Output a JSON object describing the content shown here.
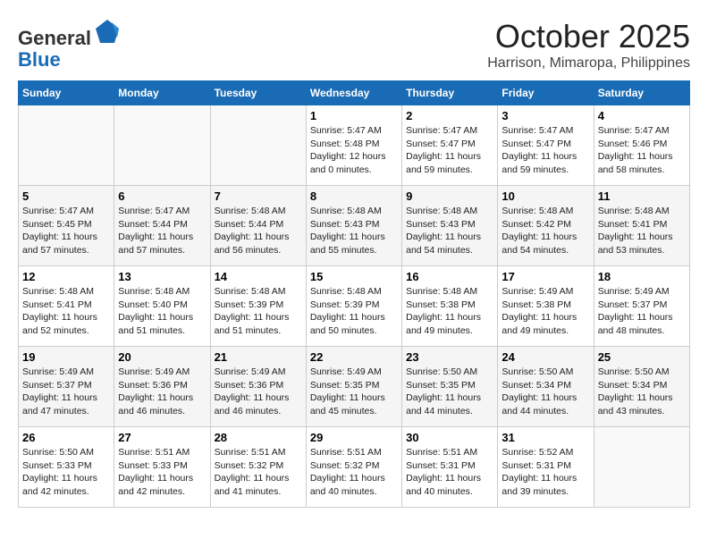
{
  "header": {
    "logo_line1": "General",
    "logo_line2": "Blue",
    "month": "October 2025",
    "location": "Harrison, Mimaropa, Philippines"
  },
  "days_of_week": [
    "Sunday",
    "Monday",
    "Tuesday",
    "Wednesday",
    "Thursday",
    "Friday",
    "Saturday"
  ],
  "weeks": [
    [
      {
        "day": "",
        "sunrise": "",
        "sunset": "",
        "daylight": ""
      },
      {
        "day": "",
        "sunrise": "",
        "sunset": "",
        "daylight": ""
      },
      {
        "day": "",
        "sunrise": "",
        "sunset": "",
        "daylight": ""
      },
      {
        "day": "1",
        "sunrise": "Sunrise: 5:47 AM",
        "sunset": "Sunset: 5:48 PM",
        "daylight": "Daylight: 12 hours and 0 minutes."
      },
      {
        "day": "2",
        "sunrise": "Sunrise: 5:47 AM",
        "sunset": "Sunset: 5:47 PM",
        "daylight": "Daylight: 11 hours and 59 minutes."
      },
      {
        "day": "3",
        "sunrise": "Sunrise: 5:47 AM",
        "sunset": "Sunset: 5:47 PM",
        "daylight": "Daylight: 11 hours and 59 minutes."
      },
      {
        "day": "4",
        "sunrise": "Sunrise: 5:47 AM",
        "sunset": "Sunset: 5:46 PM",
        "daylight": "Daylight: 11 hours and 58 minutes."
      }
    ],
    [
      {
        "day": "5",
        "sunrise": "Sunrise: 5:47 AM",
        "sunset": "Sunset: 5:45 PM",
        "daylight": "Daylight: 11 hours and 57 minutes."
      },
      {
        "day": "6",
        "sunrise": "Sunrise: 5:47 AM",
        "sunset": "Sunset: 5:44 PM",
        "daylight": "Daylight: 11 hours and 57 minutes."
      },
      {
        "day": "7",
        "sunrise": "Sunrise: 5:48 AM",
        "sunset": "Sunset: 5:44 PM",
        "daylight": "Daylight: 11 hours and 56 minutes."
      },
      {
        "day": "8",
        "sunrise": "Sunrise: 5:48 AM",
        "sunset": "Sunset: 5:43 PM",
        "daylight": "Daylight: 11 hours and 55 minutes."
      },
      {
        "day": "9",
        "sunrise": "Sunrise: 5:48 AM",
        "sunset": "Sunset: 5:43 PM",
        "daylight": "Daylight: 11 hours and 54 minutes."
      },
      {
        "day": "10",
        "sunrise": "Sunrise: 5:48 AM",
        "sunset": "Sunset: 5:42 PM",
        "daylight": "Daylight: 11 hours and 54 minutes."
      },
      {
        "day": "11",
        "sunrise": "Sunrise: 5:48 AM",
        "sunset": "Sunset: 5:41 PM",
        "daylight": "Daylight: 11 hours and 53 minutes."
      }
    ],
    [
      {
        "day": "12",
        "sunrise": "Sunrise: 5:48 AM",
        "sunset": "Sunset: 5:41 PM",
        "daylight": "Daylight: 11 hours and 52 minutes."
      },
      {
        "day": "13",
        "sunrise": "Sunrise: 5:48 AM",
        "sunset": "Sunset: 5:40 PM",
        "daylight": "Daylight: 11 hours and 51 minutes."
      },
      {
        "day": "14",
        "sunrise": "Sunrise: 5:48 AM",
        "sunset": "Sunset: 5:39 PM",
        "daylight": "Daylight: 11 hours and 51 minutes."
      },
      {
        "day": "15",
        "sunrise": "Sunrise: 5:48 AM",
        "sunset": "Sunset: 5:39 PM",
        "daylight": "Daylight: 11 hours and 50 minutes."
      },
      {
        "day": "16",
        "sunrise": "Sunrise: 5:48 AM",
        "sunset": "Sunset: 5:38 PM",
        "daylight": "Daylight: 11 hours and 49 minutes."
      },
      {
        "day": "17",
        "sunrise": "Sunrise: 5:49 AM",
        "sunset": "Sunset: 5:38 PM",
        "daylight": "Daylight: 11 hours and 49 minutes."
      },
      {
        "day": "18",
        "sunrise": "Sunrise: 5:49 AM",
        "sunset": "Sunset: 5:37 PM",
        "daylight": "Daylight: 11 hours and 48 minutes."
      }
    ],
    [
      {
        "day": "19",
        "sunrise": "Sunrise: 5:49 AM",
        "sunset": "Sunset: 5:37 PM",
        "daylight": "Daylight: 11 hours and 47 minutes."
      },
      {
        "day": "20",
        "sunrise": "Sunrise: 5:49 AM",
        "sunset": "Sunset: 5:36 PM",
        "daylight": "Daylight: 11 hours and 46 minutes."
      },
      {
        "day": "21",
        "sunrise": "Sunrise: 5:49 AM",
        "sunset": "Sunset: 5:36 PM",
        "daylight": "Daylight: 11 hours and 46 minutes."
      },
      {
        "day": "22",
        "sunrise": "Sunrise: 5:49 AM",
        "sunset": "Sunset: 5:35 PM",
        "daylight": "Daylight: 11 hours and 45 minutes."
      },
      {
        "day": "23",
        "sunrise": "Sunrise: 5:50 AM",
        "sunset": "Sunset: 5:35 PM",
        "daylight": "Daylight: 11 hours and 44 minutes."
      },
      {
        "day": "24",
        "sunrise": "Sunrise: 5:50 AM",
        "sunset": "Sunset: 5:34 PM",
        "daylight": "Daylight: 11 hours and 44 minutes."
      },
      {
        "day": "25",
        "sunrise": "Sunrise: 5:50 AM",
        "sunset": "Sunset: 5:34 PM",
        "daylight": "Daylight: 11 hours and 43 minutes."
      }
    ],
    [
      {
        "day": "26",
        "sunrise": "Sunrise: 5:50 AM",
        "sunset": "Sunset: 5:33 PM",
        "daylight": "Daylight: 11 hours and 42 minutes."
      },
      {
        "day": "27",
        "sunrise": "Sunrise: 5:51 AM",
        "sunset": "Sunset: 5:33 PM",
        "daylight": "Daylight: 11 hours and 42 minutes."
      },
      {
        "day": "28",
        "sunrise": "Sunrise: 5:51 AM",
        "sunset": "Sunset: 5:32 PM",
        "daylight": "Daylight: 11 hours and 41 minutes."
      },
      {
        "day": "29",
        "sunrise": "Sunrise: 5:51 AM",
        "sunset": "Sunset: 5:32 PM",
        "daylight": "Daylight: 11 hours and 40 minutes."
      },
      {
        "day": "30",
        "sunrise": "Sunrise: 5:51 AM",
        "sunset": "Sunset: 5:31 PM",
        "daylight": "Daylight: 11 hours and 40 minutes."
      },
      {
        "day": "31",
        "sunrise": "Sunrise: 5:52 AM",
        "sunset": "Sunset: 5:31 PM",
        "daylight": "Daylight: 11 hours and 39 minutes."
      },
      {
        "day": "",
        "sunrise": "",
        "sunset": "",
        "daylight": ""
      }
    ]
  ]
}
